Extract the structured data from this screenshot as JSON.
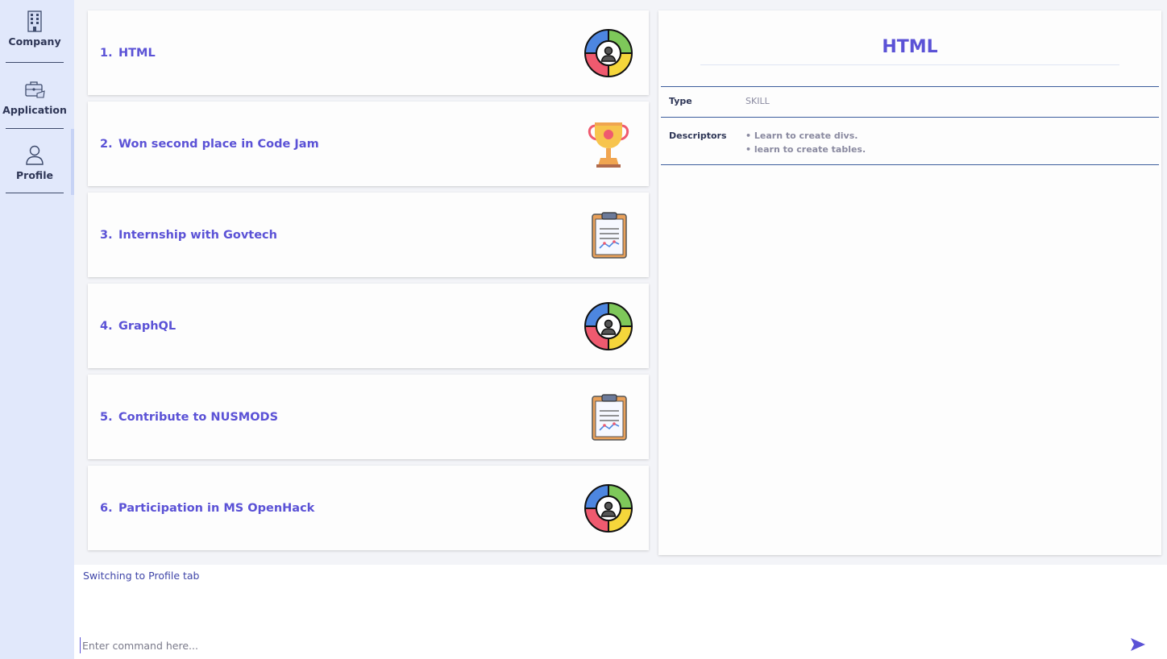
{
  "sidebar": {
    "items": [
      {
        "label": "Company",
        "icon": "building-icon"
      },
      {
        "label": "Application",
        "icon": "briefcase-icon"
      },
      {
        "label": "Profile",
        "icon": "user-icon"
      }
    ],
    "active": "Profile"
  },
  "list": {
    "items": [
      {
        "index": "1.",
        "title": "HTML",
        "icon": "skill-wheel-icon"
      },
      {
        "index": "2.",
        "title": "Won second place in Code Jam",
        "icon": "trophy-icon"
      },
      {
        "index": "3.",
        "title": "Internship with Govtech",
        "icon": "clipboard-icon"
      },
      {
        "index": "4.",
        "title": "GraphQL",
        "icon": "skill-wheel-icon"
      },
      {
        "index": "5.",
        "title": "Contribute to NUSMODS",
        "icon": "clipboard-icon"
      },
      {
        "index": "6.",
        "title": "Participation in MS OpenHack",
        "icon": "skill-wheel-icon"
      }
    ]
  },
  "detail": {
    "title": "HTML",
    "type_label": "Type",
    "type_value": "SKILL",
    "descriptors_label": "Descriptors",
    "descriptors": [
      "Learn to create divs.",
      "learn to create tables."
    ]
  },
  "result": {
    "text": "Switching to Profile tab"
  },
  "command": {
    "placeholder": "Enter command here...",
    "value": ""
  },
  "colors": {
    "accent": "#5b52d6",
    "sidebar_bg": "#e1e8fb",
    "divider": "#3b5c9c"
  }
}
